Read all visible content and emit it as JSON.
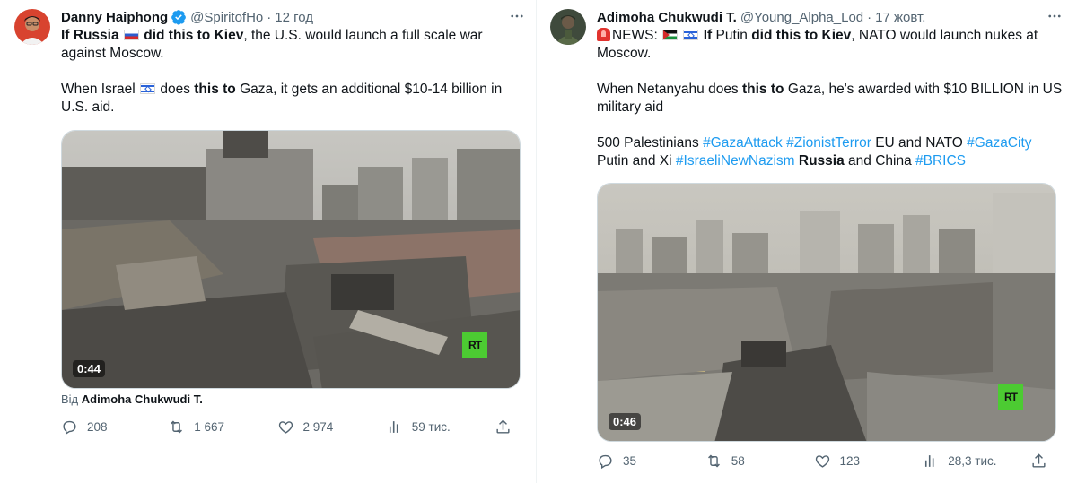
{
  "tweets": [
    {
      "author_name": "Danny Haiphong",
      "handle": "@SpiritofHo",
      "separator": "·",
      "time": "12 год",
      "verified": true,
      "text": {
        "l1_a": "If Russia",
        "l1_b": "did this to Kiev",
        "l1_c": ", the U.S. would launch a full scale war against Moscow.",
        "l2_a": "When Israel",
        "l2_b": "does",
        "l2_c": "this to",
        "l2_d": "Gaza, it gets an additional $10-14 billion in U.S. aid."
      },
      "media": {
        "duration": "0:44",
        "watermark": "RT"
      },
      "from_prefix": "Від",
      "from_name": "Adimoha Chukwudi T.",
      "stats": {
        "replies": "208",
        "reposts": "1 667",
        "likes": "2 974",
        "views": "59 тис."
      }
    },
    {
      "author_name": "Adimoha Chukwudi T.",
      "handle": "@Young_Alpha_Lod",
      "separator": "·",
      "time": "17 жовт.",
      "verified": false,
      "text": {
        "l1_news": "NEWS:",
        "l1_if": "If",
        "l1_putin": "Putin",
        "l1_did": "did this to Kiev",
        "l1_rest": ", NATO would launch nukes at Moscow.",
        "l2_a": "When Netanyahu does",
        "l2_b": "this to",
        "l2_c": "Gaza, he's awarded with $10 BILLION in US military aid",
        "l3_a": "500 Palestinians",
        "l3_tag1": "#GazaAttack",
        "l3_tag2": "#ZionistTerror",
        "l3_b": "EU and NATO",
        "l3_tag3": "#GazaCity",
        "l3_c": "Putin and Xi",
        "l3_tag4": "#IsraeliNewNazism",
        "l3_russia": "Russia",
        "l3_d": "and China",
        "l3_tag5": "#BRICS"
      },
      "media": {
        "duration": "0:46",
        "watermark": "RT"
      },
      "stats": {
        "replies": "35",
        "reposts": "58",
        "likes": "123",
        "views": "28,3 тис."
      }
    }
  ],
  "colors": {
    "text": "#0f1419",
    "secondary": "#536471",
    "link": "#1d9bf0",
    "verified": "#1d9bf0",
    "rt_green": "#4ccb32"
  },
  "icons": [
    "more-icon",
    "verified-icon",
    "reply-icon",
    "repost-icon",
    "like-icon",
    "views-icon",
    "share-icon"
  ]
}
